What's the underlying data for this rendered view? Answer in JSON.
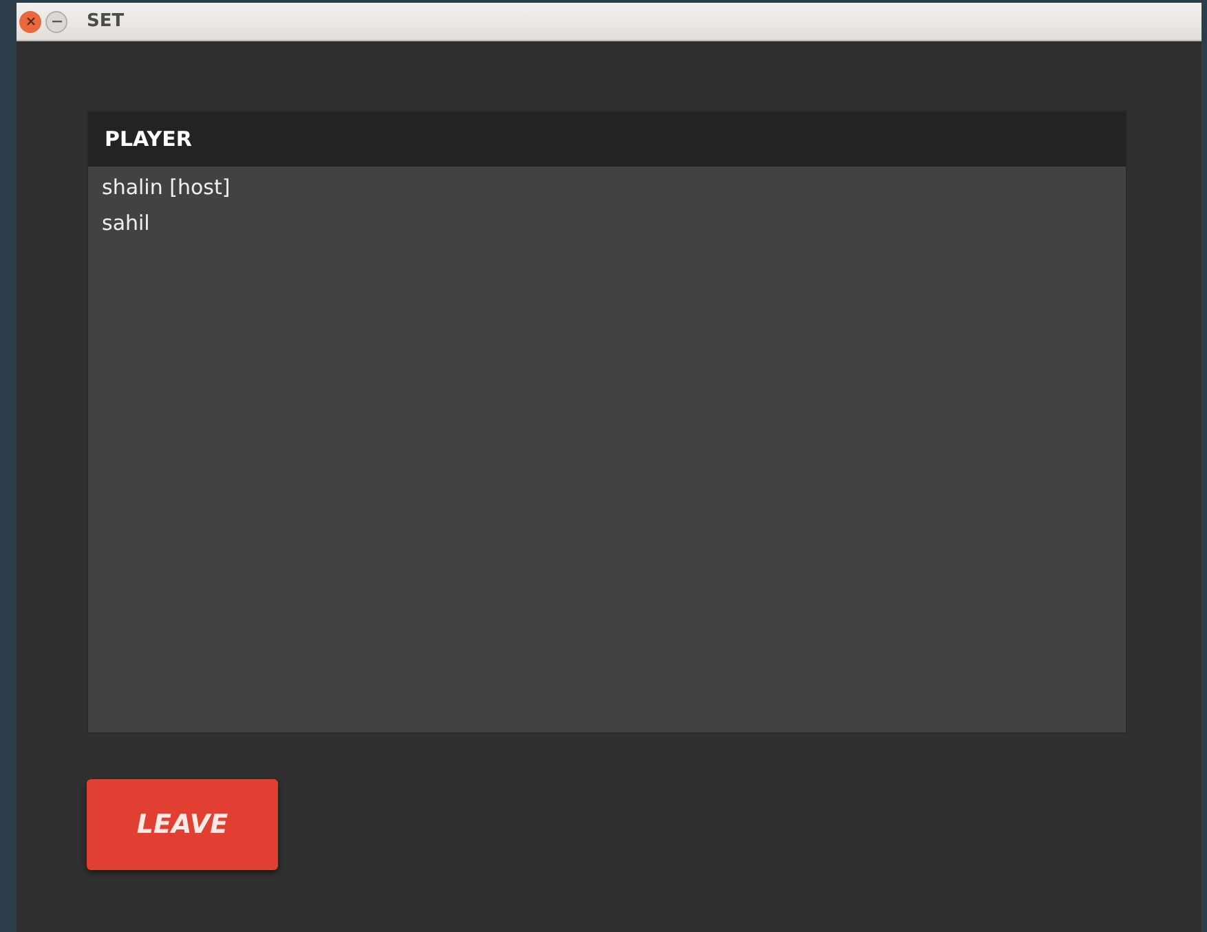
{
  "window": {
    "title": "SET"
  },
  "table": {
    "columns": [
      "PLAYER"
    ],
    "rows": [
      "shalin [host]",
      "sahil"
    ]
  },
  "buttons": [
    "LEAVE"
  ]
}
